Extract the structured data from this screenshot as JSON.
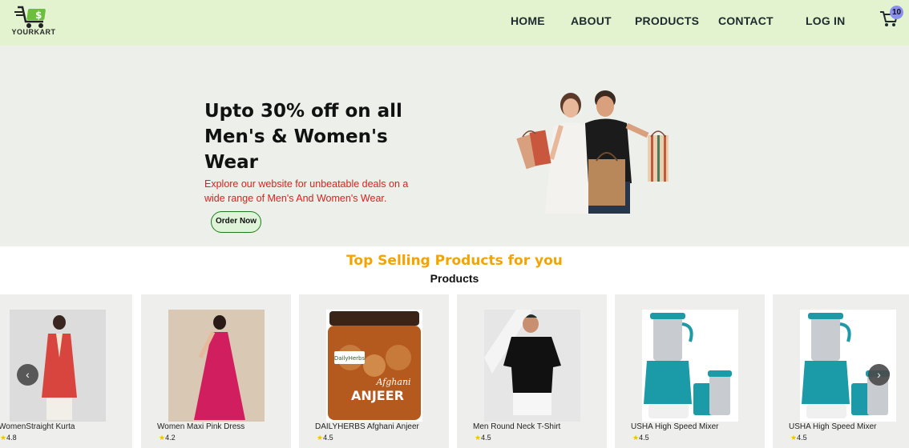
{
  "brand": {
    "logo_text": "YOURKART",
    "accent": "#e3f2cf"
  },
  "nav": {
    "home": "HOME",
    "about": "ABOUT",
    "products": "PRODUCTS",
    "contact": "CONTACT",
    "login": "LOG IN",
    "cart_count": "10"
  },
  "hero": {
    "title_line1": "Upto 30% off on all",
    "title_line2": "Men's & Women's",
    "title_line3": "Wear",
    "subtitle": "Explore our website for unbeatable deals on a wide range of Men's And Women's Wear.",
    "cta": "Order Now"
  },
  "section": {
    "title": "Top Selling Products for you",
    "subtitle": "Products"
  },
  "products": [
    {
      "name": "WomenStraight Kurta",
      "rating": "4.8",
      "icon": "kurta-image"
    },
    {
      "name": "Women Maxi Pink Dress",
      "rating": "4.2",
      "icon": "dress-image"
    },
    {
      "name": "DAILYHERBS Afghani Anjeer",
      "rating": "4.5",
      "icon": "anjeer-jar-image"
    },
    {
      "name": "Men Round Neck T-Shirt",
      "rating": "4.5",
      "icon": "tshirt-image"
    },
    {
      "name": "USHA High Speed Mixer",
      "rating": "4.5",
      "icon": "mixer-image"
    },
    {
      "name": "USHA High Speed Mixer",
      "rating": "4.5",
      "icon": "mixer-image"
    }
  ],
  "jar_label": {
    "brand": "DailyHerbs",
    "script": "Afghani",
    "name": "ANJEER"
  },
  "carousel": {
    "prev": "‹",
    "next": "›"
  },
  "colors": {
    "section_title": "#f5a300",
    "hero_sub": "#e11d1d",
    "star": "#f2c200"
  }
}
